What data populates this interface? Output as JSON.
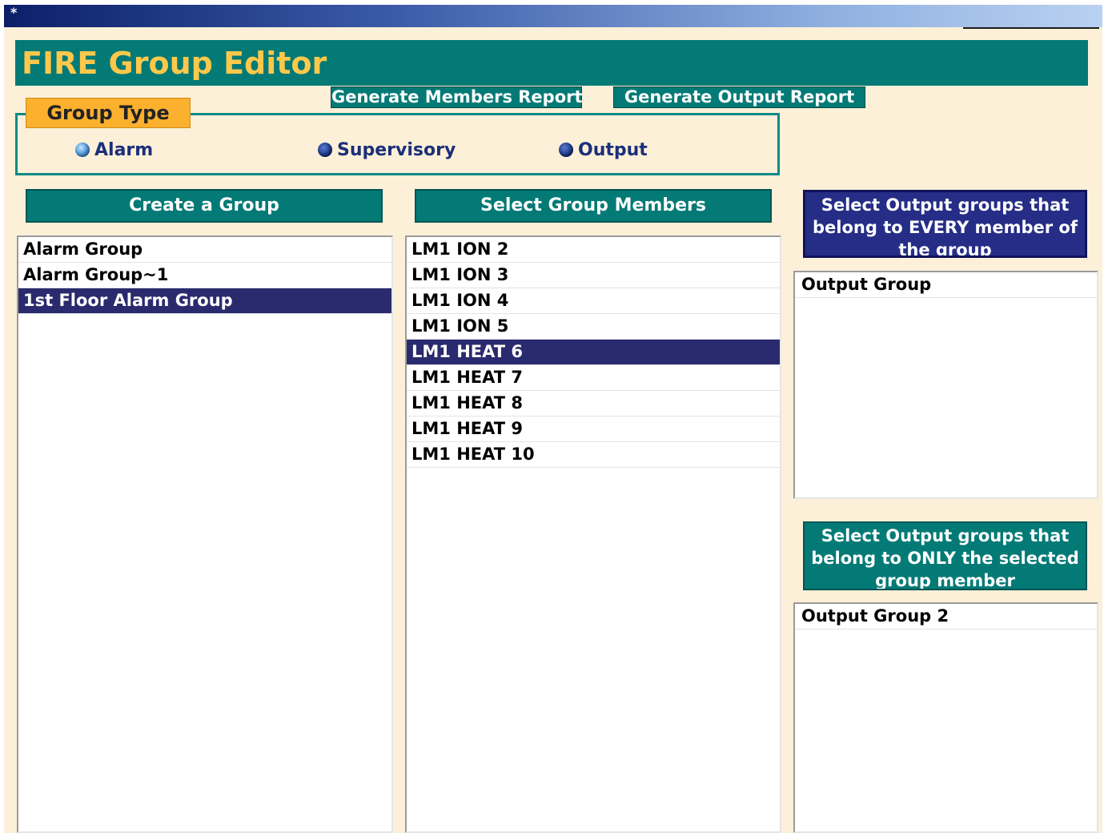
{
  "titlebar": {
    "icon": "*"
  },
  "header": {
    "title": "FIRE Group Editor"
  },
  "reports": {
    "members_label": "Generate Members Report",
    "output_label": "Generate Output Report"
  },
  "group_type": {
    "label": "Group Type",
    "options": [
      {
        "label": "Alarm",
        "selected": true
      },
      {
        "label": "Supervisory",
        "selected": false
      },
      {
        "label": "Output",
        "selected": false
      }
    ]
  },
  "create_group": {
    "button_label": "Create a Group",
    "items": [
      "Alarm Group",
      "Alarm Group~1",
      "1st Floor Alarm Group"
    ],
    "selected_index": 2
  },
  "group_members": {
    "button_label": "Select Group Members",
    "items": [
      "LM1 ION 2",
      "LM1 ION 3",
      "LM1 ION 4",
      "LM1 ION 5",
      "LM1 HEAT 6",
      "LM1 HEAT 7",
      "LM1 HEAT 8",
      "LM1 HEAT 9",
      "LM1 HEAT 10"
    ],
    "selected_index": 4
  },
  "output_every": {
    "label": "Select Output groups that belong to EVERY member of the group",
    "items": [
      "Output Group"
    ]
  },
  "output_only": {
    "label": "Select Output groups that belong to ONLY the selected group member",
    "items": [
      "Output Group 2"
    ]
  },
  "colors": {
    "background": "#fdf0d8",
    "teal": "#037a76",
    "title_gold": "#ffc84a",
    "orange": "#fbb02e",
    "navy_selected": "#2a2a6e",
    "output_header_blue": "#252d86"
  }
}
